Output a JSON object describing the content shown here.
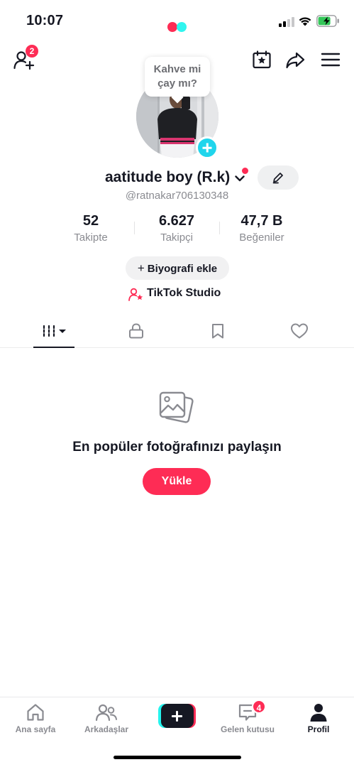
{
  "status_bar": {
    "time": "10:07"
  },
  "top_bar": {
    "friend_requests_count": "2",
    "icons": [
      "add-friend-icon",
      "calendar-star-icon",
      "share-icon",
      "menu-icon"
    ]
  },
  "profile": {
    "note_bubble": "Kahve mi çay mı?",
    "display_name": "aatitude boy (R.k)",
    "username": "@ratnakar706130348",
    "stats": [
      {
        "value": "52",
        "label": "Takipte"
      },
      {
        "value": "6.627",
        "label": "Takipçi"
      },
      {
        "value": "47,7 B",
        "label": "Beğeniler"
      }
    ],
    "bio_button": "Biyografi ekle",
    "bio_button_plus": "+",
    "studio_label": "TikTok Studio"
  },
  "tabs": [
    "videos-grid-icon",
    "lock-icon",
    "bookmark-icon",
    "heart-icon"
  ],
  "empty_state": {
    "title": "En popüler fotoğrafınızı paylaşın",
    "button": "Yükle"
  },
  "bottom_nav": {
    "items": [
      {
        "label": "Ana sayfa",
        "icon": "home-icon"
      },
      {
        "label": "Arkadaşlar",
        "icon": "friends-icon"
      },
      {
        "label": "",
        "icon": "create-plus-icon"
      },
      {
        "label": "Gelen kutusu",
        "icon": "inbox-icon",
        "badge": "4"
      },
      {
        "label": "Profil",
        "icon": "profile-icon"
      }
    ]
  },
  "colors": {
    "brand_red": "#fe2c55",
    "brand_cyan": "#25f4ee",
    "text_primary": "#161823",
    "text_secondary": "#8a8b91",
    "battery_green": "#34c759"
  }
}
